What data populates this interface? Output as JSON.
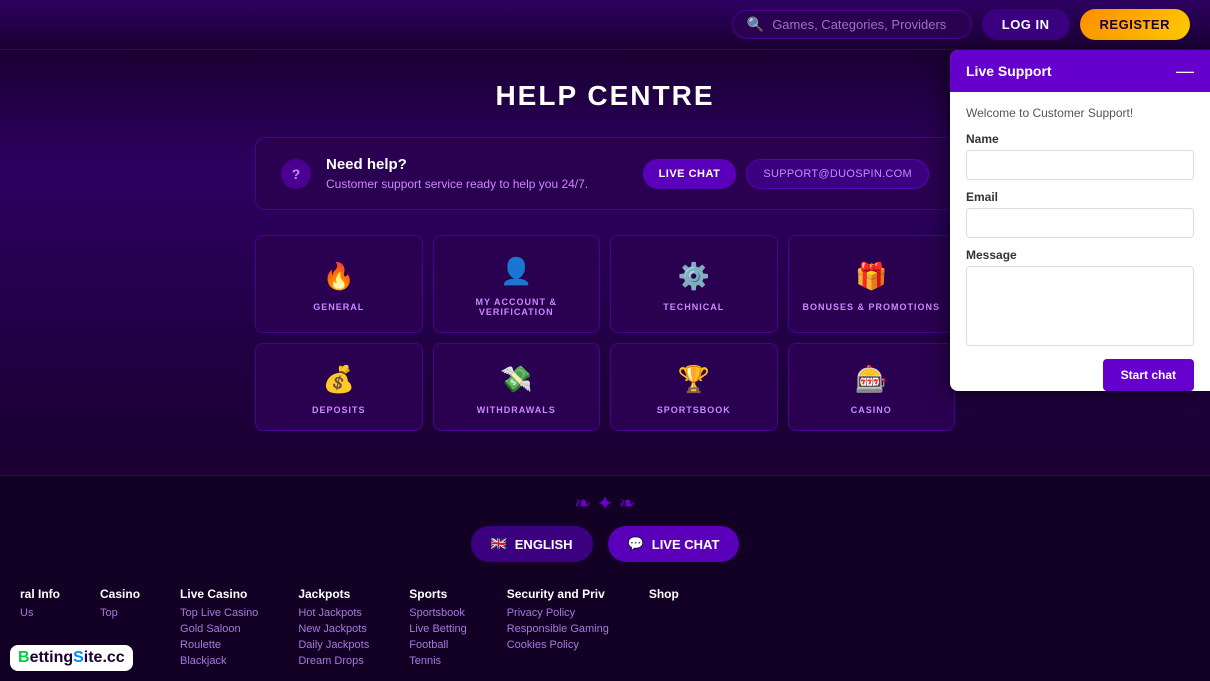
{
  "header": {
    "search_placeholder": "Games, Categories, Providers",
    "login_label": "LOG IN",
    "register_label": "REGISTER"
  },
  "page": {
    "title": "HELP CENTRE"
  },
  "help_box": {
    "question_icon": "?",
    "title": "Need help?",
    "subtitle": "Customer support service ready to help you 24/7.",
    "live_chat_label": "LIVE CHAT",
    "email_label": "SUPPORT@DUOSPIN.COM"
  },
  "categories": [
    {
      "icon": "🔥",
      "label": "GENERAL"
    },
    {
      "icon": "👤",
      "label": "MY ACCOUNT & VERIFICATION"
    },
    {
      "icon": "⚙️",
      "label": "TECHNICAL"
    },
    {
      "icon": "🎁",
      "label": "BONUSES & PROMOTIONS"
    },
    {
      "icon": "💰",
      "label": "DEPOSITS"
    },
    {
      "icon": "💸",
      "label": "WITHDRAWALS"
    },
    {
      "icon": "🏆",
      "label": "SPORTSBOOK"
    },
    {
      "icon": "🎰",
      "label": "CASINO"
    }
  ],
  "footer_buttons": {
    "language_label": "ENGLISH",
    "language_flag": "🇬🇧",
    "chat_label": "LIVE CHAT",
    "chat_icon": "💬"
  },
  "footer_columns": [
    {
      "title": "ral Info",
      "links": [
        "Us"
      ]
    },
    {
      "title": "Casino",
      "links": [
        "Top"
      ]
    },
    {
      "title": "Live Casino",
      "links": [
        "Top Live Casino",
        "Gold Saloon",
        "Roulette",
        "Blackjack"
      ]
    },
    {
      "title": "Jackpots",
      "links": [
        "Hot Jackpots",
        "New Jackpots",
        "Daily Jackpots",
        "Dream Drops"
      ]
    },
    {
      "title": "Sports",
      "links": [
        "Sportsbook",
        "Live Betting",
        "Football",
        "Tennis"
      ]
    },
    {
      "title": "Security and Priv",
      "links": [
        "Privacy Policy",
        "Responsible Gaming",
        "Cookies Policy"
      ]
    }
  ],
  "footer_extra_cols": {
    "shop_label": "Shop"
  },
  "logo": {
    "text": "BettingSite.cc"
  },
  "live_support": {
    "title": "Live Support",
    "minimize_icon": "—",
    "welcome_text": "Welcome to Customer Support!",
    "name_label": "Name",
    "email_label": "Email",
    "message_label": "Message",
    "start_chat_label": "Start chat"
  }
}
